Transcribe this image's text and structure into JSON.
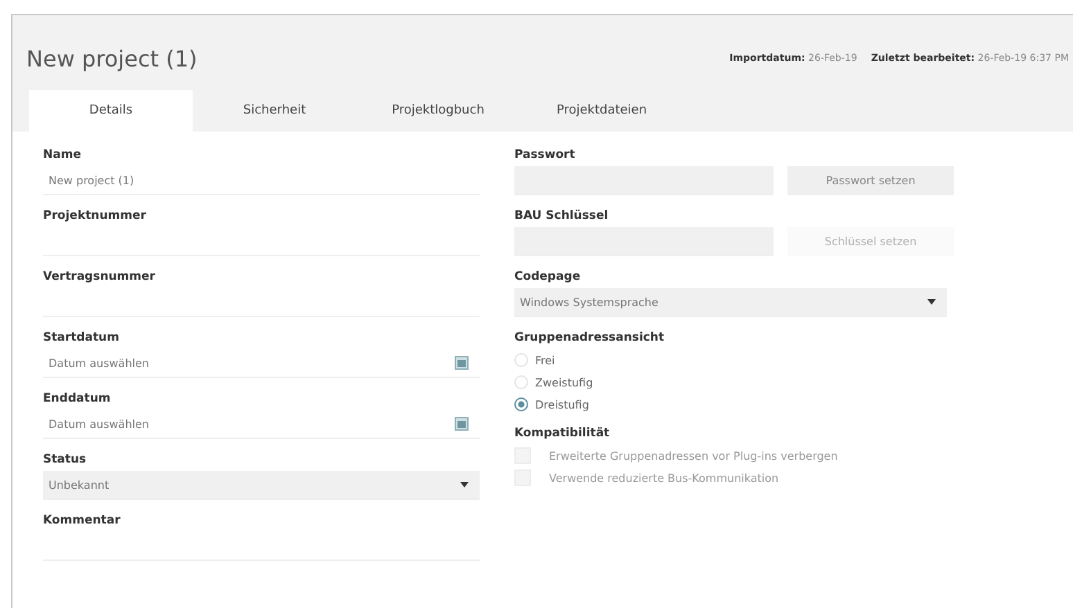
{
  "title": "New project (1)",
  "meta": [
    {
      "label": "Importdatum:",
      "value": "26-Feb-19"
    },
    {
      "label": "Zuletzt bearbeitet:",
      "value": "26-Feb-19 6:37 PM"
    }
  ],
  "tabs": [
    {
      "label": "Details",
      "selected": true
    },
    {
      "label": "Sicherheit",
      "selected": false
    },
    {
      "label": "Projektlogbuch",
      "selected": false
    },
    {
      "label": "Projektdateien",
      "selected": false
    }
  ],
  "left": [
    {
      "kind": "text",
      "label": "Name",
      "value": "New project (1)"
    },
    {
      "kind": "text",
      "label": "Projektnummer"
    },
    {
      "kind": "text",
      "label": "Vertragsnummer"
    },
    {
      "kind": "date",
      "label": "Startdatum",
      "placeholder": "Datum auswählen"
    },
    {
      "kind": "date",
      "label": "Enddatum",
      "placeholder": "Datum auswählen"
    },
    {
      "kind": "select",
      "label": "Status",
      "value": "Unbekannt"
    },
    {
      "kind": "text",
      "label": "Kommentar"
    }
  ],
  "right": {
    "password": {
      "label": "Passwort",
      "button": "Passwort setzen",
      "disabled": false
    },
    "bau": {
      "label": "BAU Schlüssel",
      "button": "Schlüssel setzen",
      "disabled": true
    },
    "codepage": {
      "label": "Codepage",
      "value": "Windows Systemsprache"
    },
    "group_view": {
      "label": "Gruppenadressansicht",
      "options": [
        {
          "label": "Frei",
          "selected": false
        },
        {
          "label": "Zweistufig",
          "selected": false
        },
        {
          "label": "Dreistufig",
          "selected": true
        }
      ]
    },
    "compat": {
      "label": "Kompatibilität",
      "options": [
        {
          "label": "Erweiterte Gruppenadressen vor Plug-ins verbergen",
          "checked": false,
          "disabled": true
        },
        {
          "label": "Verwende reduzierte Bus-Kommunikation",
          "checked": false,
          "disabled": true
        }
      ]
    }
  }
}
